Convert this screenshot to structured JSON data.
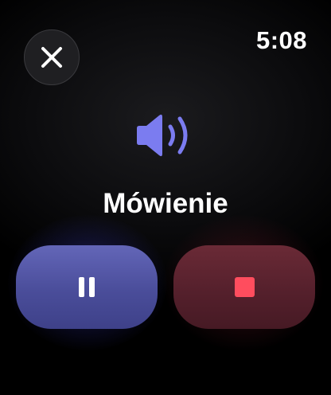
{
  "status_bar": {
    "time": "5:08"
  },
  "icons": {
    "close": "close-icon",
    "speaker": "speaker-wave-icon",
    "pause": "pause-icon",
    "stop": "stop-icon"
  },
  "main": {
    "status_label": "Mówienie"
  },
  "colors": {
    "speaker_accent": "#7b7cf0",
    "pause_button": "#5558a8",
    "stop_button": "#5e2330",
    "stop_glyph": "#ff4d5e"
  }
}
